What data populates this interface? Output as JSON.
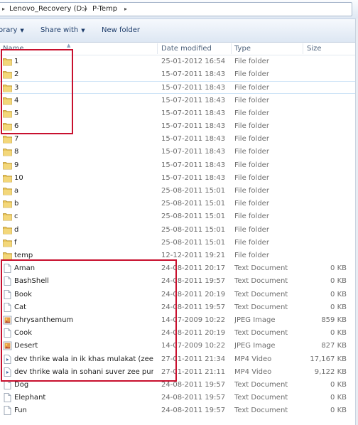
{
  "address_bar": {
    "crumbs": [
      "Lenovo_Recovery (D:)",
      "P-Temp"
    ]
  },
  "toolbar": {
    "library_label": "orary",
    "share_label": "Share with",
    "new_folder_label": "New folder"
  },
  "columns": {
    "name": "Name",
    "date": "Date modified",
    "type": "Type",
    "size": "Size"
  },
  "files": [
    {
      "name": "1",
      "date": "25-01-2012 16:54",
      "type": "File folder",
      "size": "",
      "icon": "folder-icon"
    },
    {
      "name": "2",
      "date": "15-07-2011 18:43",
      "type": "File folder",
      "size": "",
      "icon": "folder-icon"
    },
    {
      "name": "3",
      "date": "15-07-2011 18:43",
      "type": "File folder",
      "size": "",
      "icon": "folder-icon"
    },
    {
      "name": "4",
      "date": "15-07-2011 18:43",
      "type": "File folder",
      "size": "",
      "icon": "folder-icon"
    },
    {
      "name": "5",
      "date": "15-07-2011 18:43",
      "type": "File folder",
      "size": "",
      "icon": "folder-icon"
    },
    {
      "name": "6",
      "date": "15-07-2011 18:43",
      "type": "File folder",
      "size": "",
      "icon": "folder-icon"
    },
    {
      "name": "7",
      "date": "15-07-2011 18:43",
      "type": "File folder",
      "size": "",
      "icon": "folder-icon"
    },
    {
      "name": "8",
      "date": "15-07-2011 18:43",
      "type": "File folder",
      "size": "",
      "icon": "folder-icon"
    },
    {
      "name": "9",
      "date": "15-07-2011 18:43",
      "type": "File folder",
      "size": "",
      "icon": "folder-icon"
    },
    {
      "name": "10",
      "date": "15-07-2011 18:43",
      "type": "File folder",
      "size": "",
      "icon": "folder-icon"
    },
    {
      "name": "a",
      "date": "25-08-2011 15:01",
      "type": "File folder",
      "size": "",
      "icon": "folder-icon"
    },
    {
      "name": "b",
      "date": "25-08-2011 15:01",
      "type": "File folder",
      "size": "",
      "icon": "folder-icon"
    },
    {
      "name": "c",
      "date": "25-08-2011 15:01",
      "type": "File folder",
      "size": "",
      "icon": "folder-icon"
    },
    {
      "name": "d",
      "date": "25-08-2011 15:01",
      "type": "File folder",
      "size": "",
      "icon": "folder-icon"
    },
    {
      "name": "f",
      "date": "25-08-2011 15:01",
      "type": "File folder",
      "size": "",
      "icon": "folder-icon"
    },
    {
      "name": "temp",
      "date": "12-12-2011 19:21",
      "type": "File folder",
      "size": "",
      "icon": "folder-icon"
    },
    {
      "name": "Aman",
      "date": "24-08-2011 20:17",
      "type": "Text Document",
      "size": "0 KB",
      "icon": "text-document-icon"
    },
    {
      "name": "BashShell",
      "date": "24-08-2011 19:57",
      "type": "Text Document",
      "size": "0 KB",
      "icon": "text-document-icon"
    },
    {
      "name": "Book",
      "date": "24-08-2011 20:19",
      "type": "Text Document",
      "size": "0 KB",
      "icon": "text-document-icon"
    },
    {
      "name": "Cat",
      "date": "24-08-2011 19:57",
      "type": "Text Document",
      "size": "0 KB",
      "icon": "text-document-icon"
    },
    {
      "name": "Chrysanthemum",
      "date": "14-07-2009 10:22",
      "type": "JPEG Image",
      "size": "859 KB",
      "icon": "jpeg-image-icon"
    },
    {
      "name": "Cook",
      "date": "24-08-2011 20:19",
      "type": "Text Document",
      "size": "0 KB",
      "icon": "text-document-icon"
    },
    {
      "name": "Desert",
      "date": "14-07-2009 10:22",
      "type": "JPEG Image",
      "size": "827 KB",
      "icon": "jpeg-image-icon"
    },
    {
      "name": "dev thrike wala in ik khas mulakat (zee p...",
      "date": "27-01-2011 21:34",
      "type": "MP4 Video",
      "size": "17,167 KB",
      "icon": "video-file-icon"
    },
    {
      "name": "dev thrike wala in sohani suver zee punja...",
      "date": "27-01-2011 21:11",
      "type": "MP4 Video",
      "size": "9,122 KB",
      "icon": "video-file-icon"
    },
    {
      "name": "Dog",
      "date": "24-08-2011 19:57",
      "type": "Text Document",
      "size": "0 KB",
      "icon": "text-document-icon"
    },
    {
      "name": "Elephant",
      "date": "24-08-2011 19:57",
      "type": "Text Document",
      "size": "0 KB",
      "icon": "text-document-icon"
    },
    {
      "name": "Fun",
      "date": "24-08-2011 19:57",
      "type": "Text Document",
      "size": "0 KB",
      "icon": "text-document-icon"
    }
  ],
  "selected_row": 2,
  "highlight_color": "#c8102e"
}
